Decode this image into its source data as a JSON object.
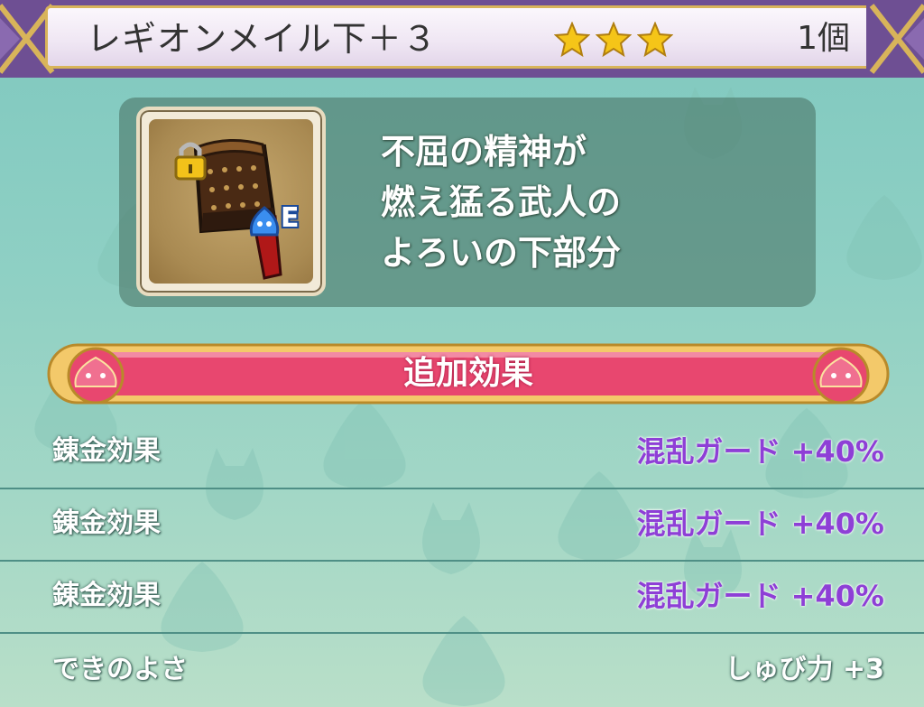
{
  "header": {
    "item_name": "レギオンメイル下＋３",
    "star_count": 3,
    "count": "1個"
  },
  "item": {
    "icon": "armor-bottom-icon",
    "lock_icon": "lock-icon",
    "equipped_badge": "E",
    "description_lines": [
      "不屈の精神が",
      "燃え猛る武人の",
      "よろいの下部分"
    ]
  },
  "banner": {
    "label": "追加効果"
  },
  "effects": [
    {
      "label": "錬金効果",
      "value": "混乱ガード +40%"
    },
    {
      "label": "錬金効果",
      "value": "混乱ガード +40%"
    },
    {
      "label": "錬金効果",
      "value": "混乱ガード +40%"
    }
  ],
  "quality": {
    "label": "できのよさ",
    "value": "しゅび力 +3"
  },
  "colors": {
    "effect_value": "#8e3fd6",
    "banner": "#e8476f",
    "frame_gold": "#d8b45a",
    "header_purple": "#6e4f93"
  }
}
